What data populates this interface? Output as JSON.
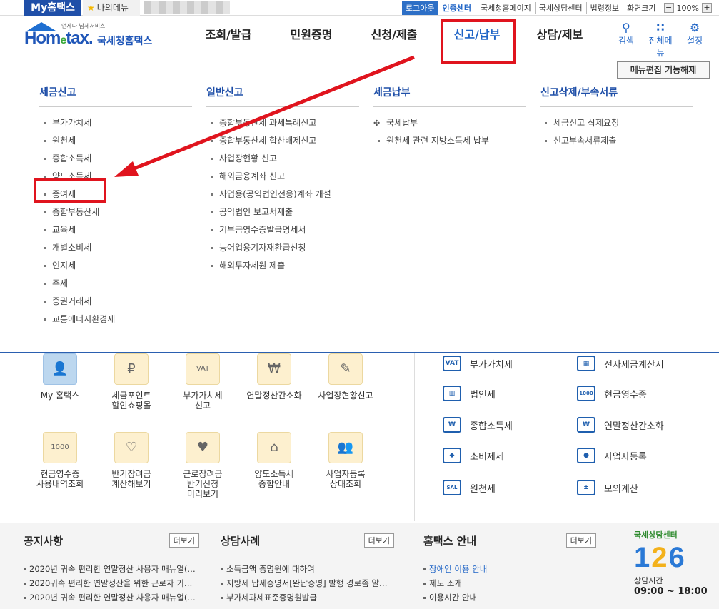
{
  "topbar": {
    "my_hometax": "My홈택스",
    "my_menu": "나의메뉴",
    "logout": "로그아웃",
    "cert_center": "인증센터",
    "links": [
      "국세청홈페이지",
      "국세상담센터",
      "법령정보",
      "화면크기"
    ],
    "zoom_minus": "−",
    "zoom_value": "100%",
    "zoom_plus": "+"
  },
  "header": {
    "logo_small": "언제나 납세서비스",
    "logo_brand": "Hom",
    "logo_e": "e",
    "logo_brand2": "tax.",
    "logo_ko": "국세청홈택스",
    "gnb": [
      "조회/발급",
      "민원증명",
      "신청/제출",
      "신고/납부",
      "상담/제보"
    ],
    "icons": [
      {
        "label": "검색",
        "icon": "search-icon"
      },
      {
        "label": "전체메뉴",
        "icon": "grid-icon"
      },
      {
        "label": "설정",
        "icon": "gear-icon"
      }
    ]
  },
  "menu_panel": {
    "edit_button": "메뉴편집 기능해제",
    "columns": [
      {
        "title": "세금신고",
        "items": [
          "부가가치세",
          "원천세",
          "종합소득세",
          "양도소득세",
          "증여세",
          "종합부동산세",
          "교육세",
          "개별소비세",
          "인지세",
          "주세",
          "증권거래세",
          "교통에너지환경세"
        ]
      },
      {
        "title": "일반신고",
        "items": [
          "종합부동산세 과세특례신고",
          "종합부동산세 합산배제신고",
          "사업장현황 신고",
          "해외금융계좌 신고",
          "사업용(공익법인전용)계좌 개설",
          "공익법인 보고서제출",
          "기부금영수증발급명세서",
          "농어업용기자재환급신청",
          "해외투자세원 제출"
        ]
      },
      {
        "title": "세금납부",
        "items": [
          "국세납부",
          "원천세 관련 지방소득세 납부"
        ]
      },
      {
        "title": "신고삭제/부속서류",
        "items": [
          "세금신고 삭제요청",
          "신고부속서류제출"
        ]
      }
    ]
  },
  "quick_menu": [
    {
      "label1": "My 홈택스",
      "label2": "",
      "label3": "",
      "icon": "user-icon"
    },
    {
      "label1": "세금포인트",
      "label2": "할인쇼핑몰",
      "label3": "",
      "icon": "bag-icon"
    },
    {
      "label1": "부가가치세",
      "label2": "신고",
      "label3": "",
      "icon": "vat-icon"
    },
    {
      "label1": "연말정산간소화",
      "label2": "",
      "label3": "",
      "icon": "money-icon"
    },
    {
      "label1": "사업장현황신고",
      "label2": "",
      "label3": "",
      "icon": "edit-icon"
    },
    {
      "label1": "현금영수증",
      "label2": "사용내역조회",
      "label3": "",
      "icon": "receipt-icon"
    },
    {
      "label1": "반기장려금",
      "label2": "계산해보기",
      "label3": "",
      "icon": "heart-card-icon"
    },
    {
      "label1": "근로장려금",
      "label2": "반기신청",
      "label3": "미리보기",
      "icon": "heart-search-icon"
    },
    {
      "label1": "양도소득세",
      "label2": "종합안내",
      "label3": "",
      "icon": "house-icon"
    },
    {
      "label1": "사업자등록",
      "label2": "상태조회",
      "label3": "",
      "icon": "users-icon"
    }
  ],
  "right_list": [
    {
      "label": "부가가치세",
      "icon": "vat-icon",
      "glyph": "VAT"
    },
    {
      "label": "전자세금계산서",
      "icon": "calculator-icon",
      "glyph": "▦"
    },
    {
      "label": "법인세",
      "icon": "building-icon",
      "glyph": "▥"
    },
    {
      "label": "현금영수증",
      "icon": "receipt-icon",
      "glyph": "1000"
    },
    {
      "label": "종합소득세",
      "icon": "money-bag-icon",
      "glyph": "₩"
    },
    {
      "label": "연말정산간소화",
      "icon": "coin-icon",
      "glyph": "₩"
    },
    {
      "label": "소비제세",
      "icon": "diamond-icon",
      "glyph": "◆"
    },
    {
      "label": "사업자등록",
      "icon": "user-icon",
      "glyph": "●"
    },
    {
      "label": "원천세",
      "icon": "document-icon",
      "glyph": "SAL"
    },
    {
      "label": "모의계산",
      "icon": "calc-icon",
      "glyph": "±"
    }
  ],
  "bottom": {
    "notice": {
      "title": "공지사항",
      "more": "더보기",
      "items": [
        "2020년 귀속 편리한 연말정산 사용자 매뉴얼(…",
        "2020귀속 편리한 연말정산을 위한 근로자 기…",
        "2020년 귀속 편리한 연말정산 사용자 매뉴얼(…"
      ]
    },
    "cases": {
      "title": "상담사례",
      "more": "더보기",
      "items": [
        "소득금액 증명원에 대하여",
        "지방세 납세증명서[완납증명] 발행 경로좀 알…",
        "부가세과세표준증명원발급"
      ]
    },
    "guide": {
      "title": "홈택스 안내",
      "more": "더보기",
      "items": [
        "장애인 이용 안내",
        "제도 소개",
        "이용시간 안내"
      ]
    },
    "call_center": {
      "title": "국세상담센터",
      "num1": "1",
      "num2": "2",
      "num3": "6",
      "sub": "상담시간",
      "hours": "09:00 ~ 18:00"
    }
  }
}
